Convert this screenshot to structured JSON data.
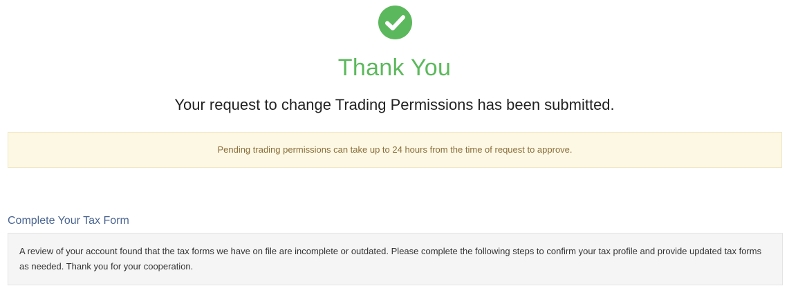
{
  "confirmation": {
    "icon": "check-circle-icon",
    "title": "Thank You",
    "message": "Your request to change Trading Permissions has been submitted."
  },
  "notice": {
    "text": "Pending trading permissions can take up to 24 hours from the time of request to approve."
  },
  "tax_section": {
    "heading": "Complete Your Tax Form",
    "body": "A review of your account found that the tax forms we have on file are incomplete or outdated. Please complete the following steps to confirm your tax profile and provide updated tax forms as needed. Thank you for your cooperation."
  },
  "colors": {
    "success_green": "#5cb85c",
    "warning_bg": "#fcf8e3",
    "warning_text": "#8a6d3b",
    "heading_blue": "#4a6592",
    "panel_bg": "#f5f5f5"
  }
}
